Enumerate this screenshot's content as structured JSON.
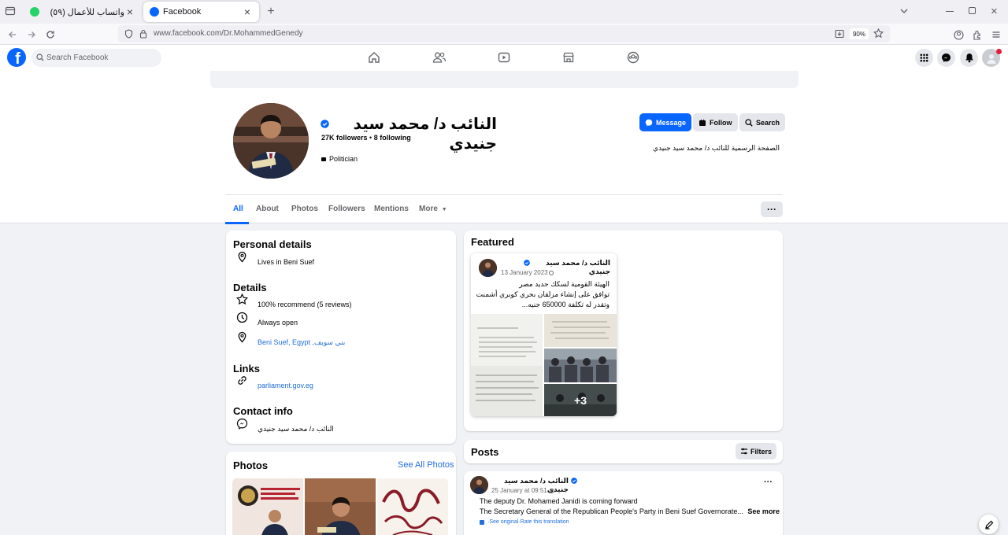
{
  "browser": {
    "tabs": [
      {
        "title": "واتساب للأعمال (٥٩)",
        "active": false
      },
      {
        "title": "Facebook",
        "active": true
      }
    ],
    "url": "www.facebook.com/Dr.MohammedGenedy",
    "zoom": "90%"
  },
  "header": {
    "search_placeholder": "Search Facebook",
    "brand_color": "#0866ff"
  },
  "profile": {
    "name": "النائب د/ محمد سيد جنيدي",
    "followers": "27K followers",
    "following": "8 following",
    "category": "Politician",
    "bio": "الصفحة الرسمية للنائب د/ محمد سيد جنيدي",
    "buttons": {
      "message": "Message",
      "follow": "Follow",
      "search": "Search"
    },
    "tabs": [
      "All",
      "About",
      "Photos",
      "Followers",
      "Mentions",
      "More"
    ]
  },
  "intro": {
    "personal_title": "Personal details",
    "lives": "Lives in Beni Suef",
    "details_title": "Details",
    "recommend": "100% recommend (5 reviews)",
    "hours": "Always open",
    "address": "Beni Suef, Egypt ,بني سويف",
    "links_title": "Links",
    "website": "parliament.gov.eg",
    "contact_title": "Contact info",
    "messenger": "النائب د/ محمد سيد جنيدي"
  },
  "photos": {
    "title": "Photos",
    "see_all": "See All Photos"
  },
  "featured": {
    "title": "Featured",
    "author": "النائب د/ محمد سيد جنيدي",
    "date": "13 January 2023",
    "line1": "الهيئة القومية لسكك حديد مصر",
    "line2": "توافق على إنشاء مزلقان بحري كوبري أشمنت",
    "line3": "وتقدر له تكلفة 650000 جنيه...",
    "more_count": "+3"
  },
  "posts": {
    "title": "Posts",
    "filters": "Filters",
    "post": {
      "author": "النائب د/ محمد سيد جنيدي",
      "date": "25 January at 09:51",
      "line1": "The deputy Dr. Mohamed Janidi is coming forward",
      "line2": "The Secretary General of the Republican People's Party in Beni Suef Governorate...",
      "see_more": "See more",
      "see_original": "See original",
      "rate": "Rate this translation"
    }
  }
}
